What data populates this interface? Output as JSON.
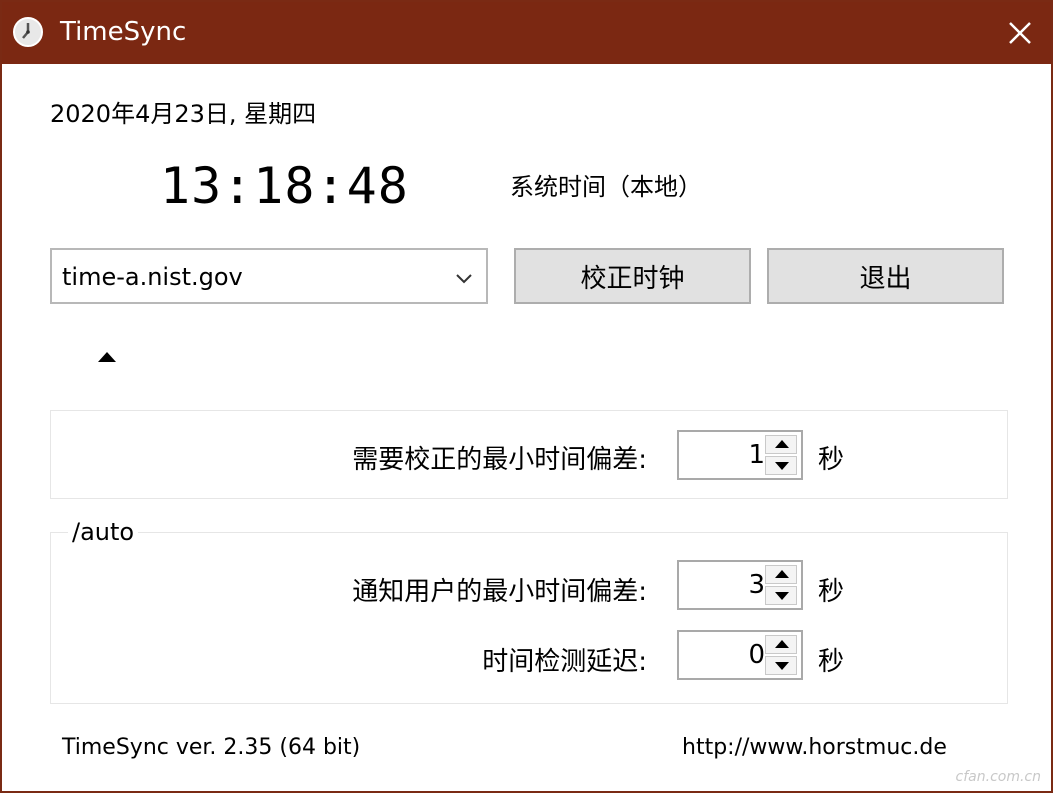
{
  "window": {
    "title": "TimeSync",
    "title_bar_color": "#7b2812"
  },
  "date": "2020年4月23日, 星期四",
  "clock": {
    "time": "13:18:48",
    "caption": "系统时间（本地）"
  },
  "server": {
    "selected": "time-a.nist.gov"
  },
  "buttons": {
    "sync_label": "校正时钟",
    "exit_label": "退出"
  },
  "settings": {
    "min_correction": {
      "label": "需要校正的最小时间偏差:",
      "value": "1",
      "unit": "秒"
    },
    "auto_group_label": "/auto",
    "min_notify": {
      "label": "通知用户的最小时间偏差:",
      "value": "3",
      "unit": "秒"
    },
    "check_delay": {
      "label": "时间检测延迟:",
      "value": "0",
      "unit": "秒"
    }
  },
  "footer": {
    "version": "TimeSync ver. 2.35 (64 bit)",
    "url": "http://www.horstmuc.de"
  },
  "watermark": "cfan.com.cn",
  "icons": [
    "clock-icon",
    "close-icon",
    "chevron-down-icon",
    "collapse-arrow-icon",
    "spin-up-icon",
    "spin-down-icon"
  ]
}
